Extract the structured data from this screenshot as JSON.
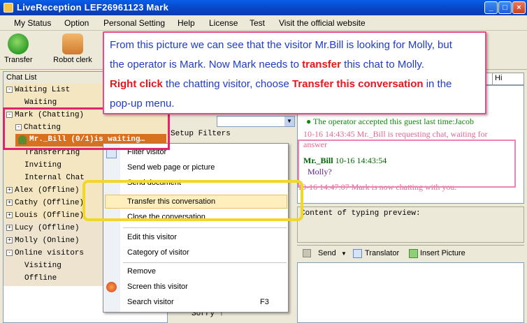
{
  "window": {
    "title": "LiveReception   LEF26961123 Mark"
  },
  "menu": [
    "My Status",
    "Option",
    "Personal Setting",
    "Help",
    "License",
    "Test",
    "Visit the official website"
  ],
  "toolbar": {
    "transfer": "Transfer",
    "robot": "Robot clerk"
  },
  "left": {
    "header": "Chat List",
    "tree": [
      {
        "box": "-",
        "label": "Waiting List"
      },
      {
        "box": "",
        "label": "Waiting"
      },
      {
        "box": "-",
        "label": "Mark (Chatting)"
      },
      {
        "box": "-",
        "label": "Chatting"
      },
      {
        "box": "",
        "label": "Transferring"
      },
      {
        "box": "",
        "label": "Inviting"
      },
      {
        "box": "",
        "label": "Internal Chat"
      },
      {
        "box": "+",
        "label": "Alex (Offline)"
      },
      {
        "box": "+",
        "label": "Cathy (Offline)"
      },
      {
        "box": "+",
        "label": "Louis (Offline)"
      },
      {
        "box": "+",
        "label": "Lucy (Offline)"
      },
      {
        "box": "+",
        "label": "Molly (Online)"
      },
      {
        "box": "-",
        "label": "Online visitors"
      },
      {
        "box": "",
        "label": "Visiting"
      },
      {
        "box": "",
        "label": "Offline"
      }
    ],
    "selected_visitor": "Mr._Bill (0/1)is waiting…"
  },
  "middle": {
    "setup_filters": "Setup Filters",
    "sorry": "Sorry !"
  },
  "chat": {
    "tab_hi": "Hi",
    "msg1": "The operator accepted this guest last time:Jacob",
    "msg2": "10-16 14:43:45   Mr._Bill is requesting chat, waiting for answer",
    "msg3_name": "Mr._Bill",
    "msg3_time": "10-16 14:43:54",
    "msg3_text": "Molly?",
    "msg4": "10-16 14:47:07   Mark is now chatting with you.",
    "typing_label": "Content of typing preview:",
    "send": "Send",
    "translator": "Translator",
    "insert_picture": "Insert Picture"
  },
  "context_menu": {
    "filter_visitor": "Filter visitor",
    "send_web_page": "Send web page or picture",
    "send_document": "Send document",
    "transfer": "Transfer this conversation",
    "close": "Close the conversation",
    "edit": "Edit this visitor",
    "category": "Category of visitor",
    "remove": "Remove",
    "screen": "Screen this visitor",
    "search": "Search visitor",
    "search_shortcut": "F3"
  },
  "callout": {
    "line1": "From this picture we can see that the visitor Mr.Bill is looking for Molly, but",
    "line2_a": "the operator is Mark. Now Mark needs to ",
    "line2_b": "transfer",
    "line2_c": " this chat to Molly.",
    "line3_a": "Right click",
    "line3_b": " the chatting visitor, choose ",
    "line3_c": "Transfer this conversation",
    "line3_d": " in the",
    "line4": "pop-up menu."
  }
}
